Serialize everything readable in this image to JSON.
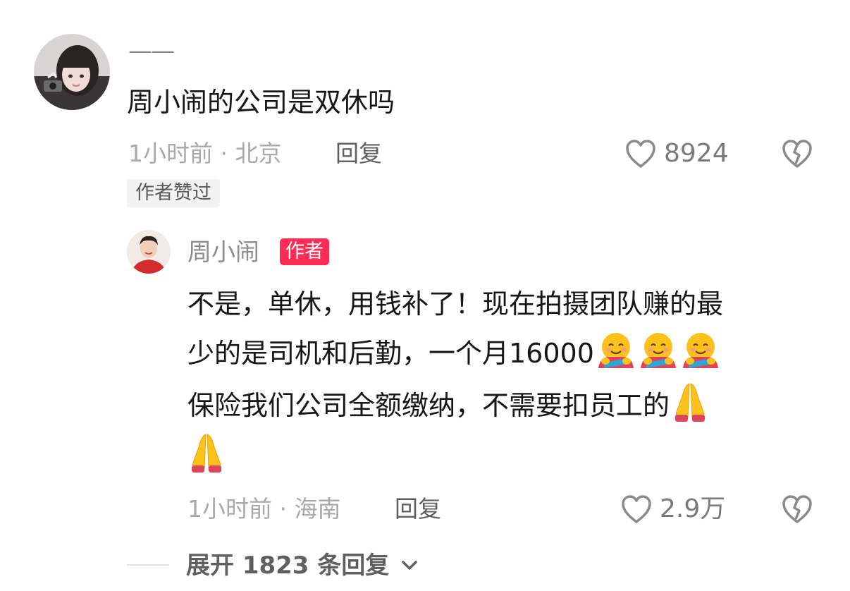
{
  "comment": {
    "username": "——",
    "text": "周小闹的公司是双休吗",
    "meta": "1小时前 · 北京",
    "reply_label": "回复",
    "like_count": "8924",
    "badge": "作者赞过"
  },
  "reply": {
    "username": "周小闹",
    "author_badge": "作者",
    "text_line1": "不是，单休，用钱补了！现在拍摄团队赚的最",
    "text_line2": "少的是司机和后勤，一个月16000",
    "text_line3": "保险我们公司全额缴纳，不需要扣员工的",
    "emoji_hug": "hug-emoji",
    "emoji_pray": "pray-emoji",
    "meta": "1小时前 · 海南",
    "reply_label": "回复",
    "like_count": "2.9万"
  },
  "expand": {
    "label": "展开 1823 条回复"
  },
  "colors": {
    "author_badge": "#fe2c55",
    "meta_text": "#a9a9a9"
  }
}
